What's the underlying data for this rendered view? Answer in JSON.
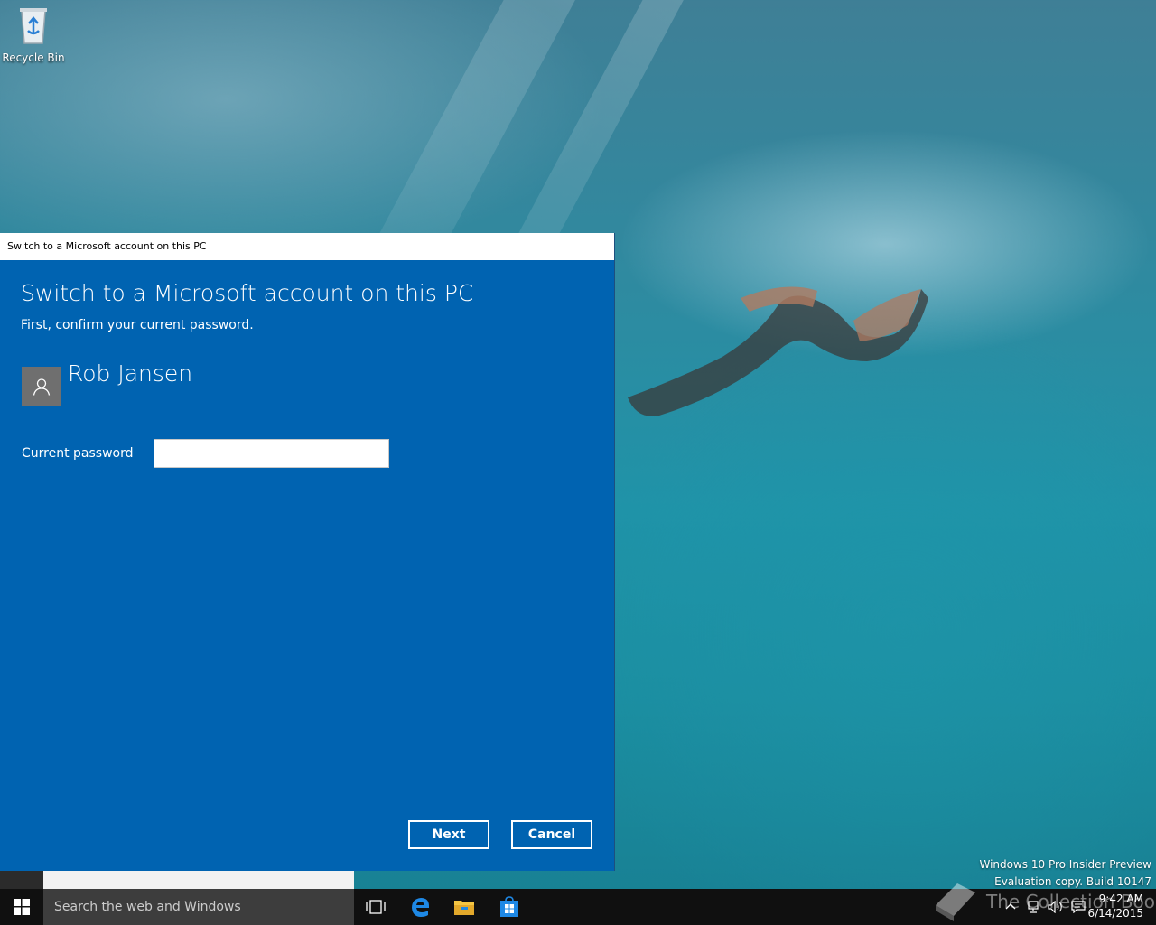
{
  "desktop": {
    "recycle_bin_label": "Recycle Bin",
    "watermark_line1": "Windows 10 Pro Insider Preview",
    "watermark_line2": "Evaluation copy. Build 10147",
    "brand_overlay": "The Collection Book"
  },
  "dialog": {
    "window_title": "Switch to a Microsoft account on this PC",
    "heading": "Switch to a Microsoft account on this PC",
    "subheading": "First, confirm your current password.",
    "user_name": "Rob Jansen",
    "password_label": "Current password",
    "password_value": "",
    "next_label": "Next",
    "cancel_label": "Cancel",
    "accent": "#0063b1"
  },
  "taskbar": {
    "search_placeholder": "Search the web and Windows",
    "time": "9:42 AM",
    "date": "6/14/2015",
    "icons": [
      "windows-start-icon",
      "task-view-icon",
      "edge-icon",
      "file-explorer-icon",
      "store-icon"
    ],
    "tray_icons": [
      "chevron-up-icon",
      "network-icon",
      "volume-icon",
      "action-center-icon"
    ]
  }
}
